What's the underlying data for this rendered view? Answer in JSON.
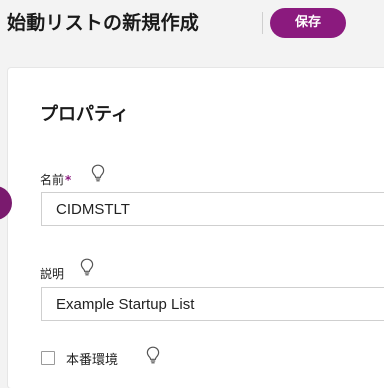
{
  "header": {
    "title": "始動リストの新規作成",
    "save_label": "保存",
    "accent_color": "#8b1a7e"
  },
  "properties": {
    "section_title": "プロパティ",
    "name": {
      "label": "名前",
      "required_mark": "*",
      "value": "CIDMSTLT",
      "hint_icon": "lightbulb-icon"
    },
    "description": {
      "label": "説明",
      "value": "Example Startup List",
      "hint_icon": "lightbulb-icon"
    },
    "production": {
      "label": "本番環境",
      "checked": false,
      "hint_icon": "lightbulb-icon"
    }
  }
}
